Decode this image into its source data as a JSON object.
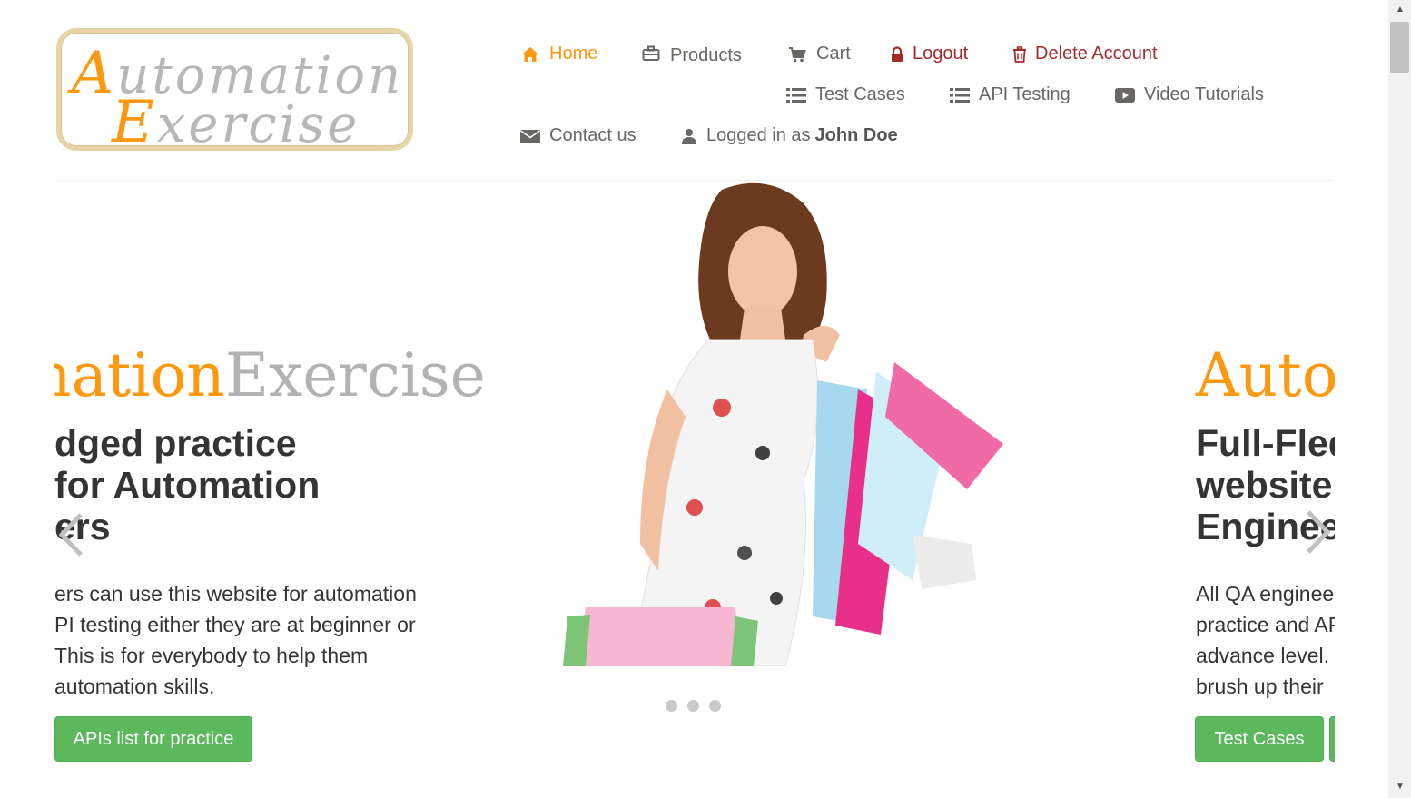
{
  "logo": {
    "line1_cap": "A",
    "line1_rest": "utomation",
    "line2_cap": "E",
    "line2_rest": "xercise"
  },
  "nav": {
    "home": "Home",
    "products": "Products",
    "cart": "Cart",
    "logout": "Logout",
    "delete_account": "Delete Account",
    "test_cases": "Test Cases",
    "api_testing": "API Testing",
    "video_tutorials": "Video Tutorials",
    "contact_us": "Contact us",
    "logged_in_prefix": "Logged in as",
    "username": "John Doe"
  },
  "slide_left": {
    "brand_orange": "mation",
    "brand_gray": "Exercise",
    "heading": [
      "dged practice",
      " for Automation",
      "ers"
    ],
    "paragraph": [
      "ers can use this website for automation",
      "PI testing either they are at beginner or",
      " This is for everybody to help them",
      "automation skills."
    ],
    "button": "APIs list for practice"
  },
  "slide_right": {
    "brand_orange": "Autom",
    "heading": [
      "Full-Fledged",
      "website for",
      "Engineers"
    ],
    "paragraph": [
      "All QA engineers",
      "practice and API",
      "advance level.",
      "brush up their"
    ],
    "button": "Test Cases"
  },
  "carousel": {
    "dots": 3,
    "active_index": 0
  },
  "colors": {
    "accent": "#fe980f",
    "danger": "#a52a2a",
    "button": "#5cb85c",
    "text": "#696763"
  },
  "icons": [
    "home-icon",
    "briefcase-icon",
    "cart-icon",
    "lock-icon",
    "trash-icon",
    "list-icon",
    "play-icon",
    "envelope-icon",
    "user-icon",
    "chevron-left-icon",
    "chevron-right-icon"
  ]
}
